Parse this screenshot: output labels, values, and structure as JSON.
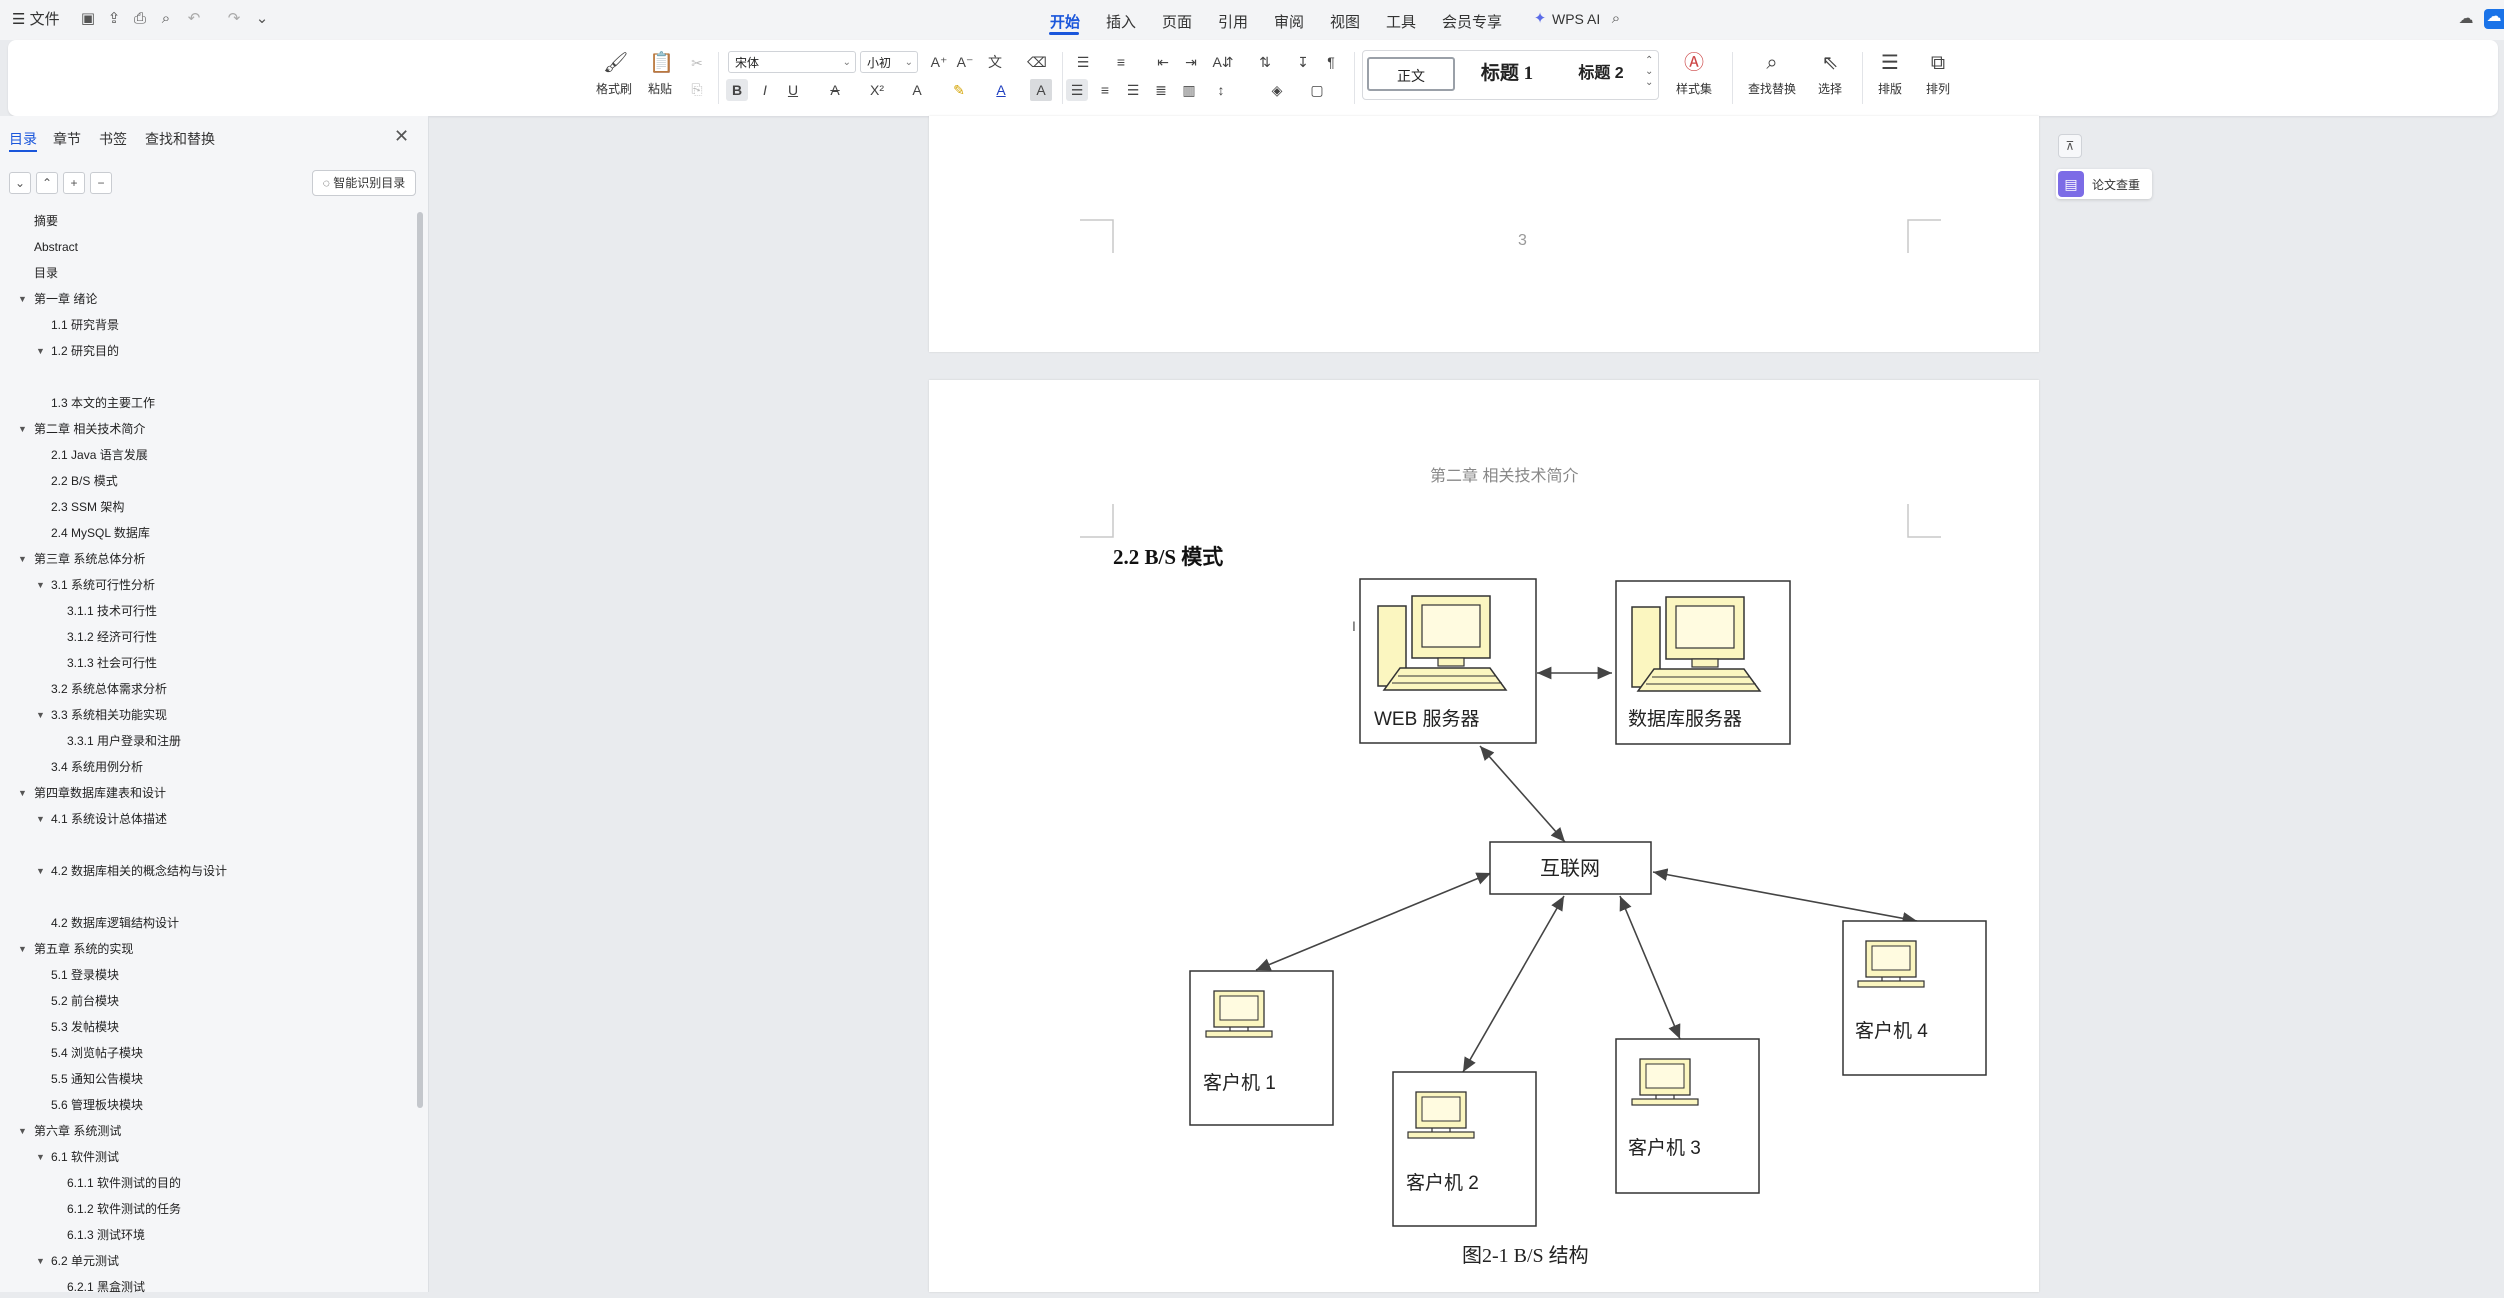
{
  "titlebar": {
    "file_menu": "☰ 文件",
    "tabs": [
      "开始",
      "插入",
      "页面",
      "引用",
      "审阅",
      "视图",
      "工具",
      "会员专享"
    ],
    "active_tab": "开始",
    "wps_ai": "WPS AI"
  },
  "ribbon": {
    "format_painter": "格式刷",
    "paste": "粘贴",
    "font_name": "宋体",
    "font_size": "小初",
    "styles": [
      "正文",
      "标题 1",
      "标题 2"
    ],
    "style_set": "样式集",
    "find_replace": "查找替换",
    "select": "选择",
    "layout": "排版",
    "arrange": "排列"
  },
  "sidepanel": {
    "tabs": [
      "目录",
      "章节",
      "书签",
      "查找和替换"
    ],
    "active_tab": "目录",
    "smart_toc": "智能识别目录",
    "toc": [
      {
        "text": "摘要",
        "level": 0,
        "tri": false
      },
      {
        "text": "Abstract",
        "level": 0,
        "tri": false
      },
      {
        "text": "目录",
        "level": 0,
        "tri": false
      },
      {
        "text": "第一章  绪论",
        "level": 0,
        "tri": true
      },
      {
        "text": "1.1 研究背景",
        "level": 1,
        "tri": false
      },
      {
        "text": "1.2 研究目的",
        "level": 1,
        "tri": true
      },
      {
        "text": "",
        "level": 1,
        "tri": false
      },
      {
        "text": "1.3  本文的主要工作",
        "level": 1,
        "tri": false
      },
      {
        "text": "第二章  相关技术简介",
        "level": 0,
        "tri": true
      },
      {
        "text": "2.1 Java 语言发展",
        "level": 1,
        "tri": false
      },
      {
        "text": "2.2 B/S 模式",
        "level": 1,
        "tri": false
      },
      {
        "text": "2.3 SSM 架构",
        "level": 1,
        "tri": false
      },
      {
        "text": "2.4 MySQL 数据库",
        "level": 1,
        "tri": false
      },
      {
        "text": "第三章  系统总体分析",
        "level": 0,
        "tri": true
      },
      {
        "text": "3.1  系统可行性分析",
        "level": 1,
        "tri": true
      },
      {
        "text": "3.1.1  技术可行性",
        "level": 2,
        "tri": false
      },
      {
        "text": "3.1.2  经济可行性",
        "level": 2,
        "tri": false
      },
      {
        "text": "3.1.3  社会可行性",
        "level": 2,
        "tri": false
      },
      {
        "text": "3.2  系统总体需求分析",
        "level": 1,
        "tri": false
      },
      {
        "text": "3.3  系统相关功能实现",
        "level": 1,
        "tri": true
      },
      {
        "text": "3.3.1  用户登录和注册",
        "level": 2,
        "tri": false
      },
      {
        "text": "3.4 系统用例分析",
        "level": 1,
        "tri": false
      },
      {
        "text": "第四章数据库建表和设计",
        "level": 0,
        "tri": true
      },
      {
        "text": "4.1 系统设计总体描述",
        "level": 1,
        "tri": true
      },
      {
        "text": "",
        "level": 1,
        "tri": false
      },
      {
        "text": "4.2  数据库相关的概念结构与设计",
        "level": 1,
        "tri": true
      },
      {
        "text": "",
        "level": 1,
        "tri": false
      },
      {
        "text": "4.2  数据库逻辑结构设计",
        "level": 1,
        "tri": false
      },
      {
        "text": "第五章  系统的实现",
        "level": 0,
        "tri": true
      },
      {
        "text": "5.1  登录模块",
        "level": 1,
        "tri": false
      },
      {
        "text": "5.2  前台模块",
        "level": 1,
        "tri": false
      },
      {
        "text": "5.3  发帖模块",
        "level": 1,
        "tri": false
      },
      {
        "text": "5.4  浏览帖子模块",
        "level": 1,
        "tri": false
      },
      {
        "text": "5.5  通知公告模块",
        "level": 1,
        "tri": false
      },
      {
        "text": "5.6  管理板块模块",
        "level": 1,
        "tri": false
      },
      {
        "text": "第六章  系统测试",
        "level": 0,
        "tri": true
      },
      {
        "text": "6.1  软件测试",
        "level": 1,
        "tri": true
      },
      {
        "text": "6.1.1 软件测试的目的",
        "level": 2,
        "tri": false
      },
      {
        "text": "6.1.2 软件测试的任务",
        "level": 2,
        "tri": false
      },
      {
        "text": "6.1.3  测试环境",
        "level": 2,
        "tri": false
      },
      {
        "text": "6.2  单元测试",
        "level": 1,
        "tri": true
      },
      {
        "text": "6.2.1 黑盒测试",
        "level": 2,
        "tri": false
      }
    ]
  },
  "document": {
    "page_number": "3",
    "header": "第二章  相关技术简介",
    "section_title": "2.2  B/S 模式",
    "figure_caption": "图2-1 B/S 结构",
    "diagram": {
      "web_server": "WEB 服务器",
      "db_server": "数据库服务器",
      "internet": "互联网",
      "clients": [
        "客户机 1",
        "客户机 2",
        "客户机 3",
        "客户机 4"
      ]
    }
  },
  "rightpanel": {
    "paper_check": "论文查重"
  }
}
